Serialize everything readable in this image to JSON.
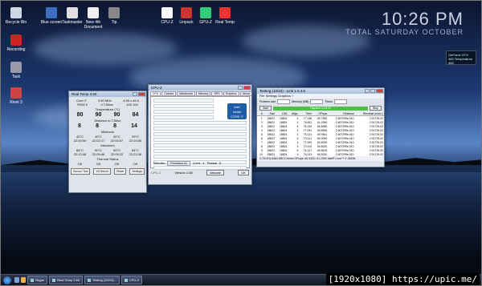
{
  "desktop": {
    "icons": [
      "Recycle Bin",
      "Blue screen",
      "Taskmaster",
      "New 4th Document",
      "Tip",
      "CPU-Z",
      "Linpack",
      "GPU-Z",
      "Real Temp",
      "Recording",
      "Task",
      "Rivet 3"
    ],
    "clock": {
      "time": "10:26 PM",
      "date": "TOTAL SATURDAY OCTOBER"
    },
    "gadget": "GeForce GTX 460 Temperature 46C"
  },
  "realtemp": {
    "title": "Real Temp 3.60",
    "head": [
      "Core i7",
      "3.80 MHz",
      "4.55 x 46.0"
    ],
    "sub": [
      "ROM 0",
      "4 TJMax",
      "100 100"
    ],
    "temp_label": "Temperature (°C)",
    "temps": [
      "80",
      "90",
      "90",
      "84"
    ],
    "dist_label": "Distance to TJMax",
    "dists": [
      "8",
      "8",
      "8",
      "14"
    ],
    "min_label": "Minimum",
    "mins": [
      "40°C",
      "40°C",
      "40°C",
      "39°C"
    ],
    "min_times": [
      "22:00:50",
      "22:02:17",
      "22:00:57",
      "22:24:50"
    ],
    "max_label": "Maximum",
    "maxs": [
      "84°C",
      "90°C",
      "90°C",
      "84°C"
    ],
    "max_times": [
      "22:12:08",
      "22:09:46",
      "22:09:22",
      "22:22:36"
    ],
    "thermal_label": "Thermal Status",
    "thermal": [
      "OK",
      "OK",
      "OK",
      "OK"
    ],
    "buttons": [
      "Sensor Test",
      "XS Bench",
      "Reset",
      "Settings"
    ]
  },
  "cpuz": {
    "title": "CPU-Z",
    "tabs": [
      "CPU",
      "Caches",
      "Mainboard",
      "Memory",
      "SPD",
      "Graphics",
      "About"
    ],
    "logo_lines": [
      "intel",
      "inside",
      "CORE i7"
    ],
    "selection_label": "Selection",
    "selection": "Processor #1",
    "cores_label": "Cores",
    "cores": "4",
    "threads_label": "Threads",
    "threads": "8",
    "brand": "CPU-Z",
    "version": "Version 1.58",
    "validate": "Validate",
    "ok": "OK"
  },
  "linpack": {
    "title": "Testing (10/10) - Link 1.0.4.5",
    "menu": [
      "File",
      "Settings",
      "Graphics",
      "?"
    ],
    "problem_size_label": "Problem size",
    "memory_label": "Memory (MB)",
    "times_label": "Times",
    "start": "Start",
    "elapsed": "Elapsed 1:10:22",
    "stop": "Stop",
    "columns": [
      "#",
      "Size",
      "LDA",
      "Align.",
      "Time",
      "GFlops",
      "Residual",
      "Residual (norm.)"
    ],
    "rows": [
      [
        "1",
        "18822",
        "18824",
        "4",
        "77.146",
        "60.7830",
        "2.607299e-010",
        "2.91725-02"
      ],
      [
        "2",
        "18822",
        "18824",
        "4",
        "76.811",
        "61.2050",
        "2.607299e-010",
        "2.91725-02"
      ],
      [
        "3",
        "18822",
        "18824",
        "4",
        "75.120",
        "60.8380",
        "2.607299e-010",
        "2.91725-02"
      ],
      [
        "4",
        "18822",
        "18824",
        "4",
        "77.091",
        "60.8480",
        "2.607299e-010",
        "2.91725-02"
      ],
      [
        "5",
        "18822",
        "18824",
        "4",
        "75.121",
        "60.9811",
        "2.607299e-010",
        "2.91725-02"
      ],
      [
        "6",
        "18822",
        "18824",
        "4",
        "73.121",
        "60.0000",
        "2.607299e-010",
        "2.91725-02"
      ],
      [
        "7",
        "18822",
        "18824",
        "4",
        "77.000",
        "60.8209",
        "2.607299e-010",
        "2.91725-02"
      ],
      [
        "8",
        "18822",
        "18824",
        "4",
        "73.120",
        "60.8020",
        "2.607299e-010",
        "2.91725-02"
      ],
      [
        "9",
        "18822",
        "18824",
        "4",
        "74.127",
        "60.8100",
        "2.607299e-010",
        "2.91725-02"
      ],
      [
        "10",
        "18822",
        "18824",
        "4",
        "76.131",
        "60.9320",
        "2.607299e-010",
        "2.91725-02"
      ]
    ],
    "status": "3.78 GHz   6484 MB   10 times   GFlops: 60.4333 / 61.2050   Intel® Core™ i7-2600K"
  },
  "taskbar": {
    "items": [
      "Skype",
      "Real Temp 3.60",
      "Testing (10/10)...",
      "CPU-Z"
    ],
    "tray_time": "22:26"
  },
  "watermark": "[1920x1080] https://upic.me/"
}
